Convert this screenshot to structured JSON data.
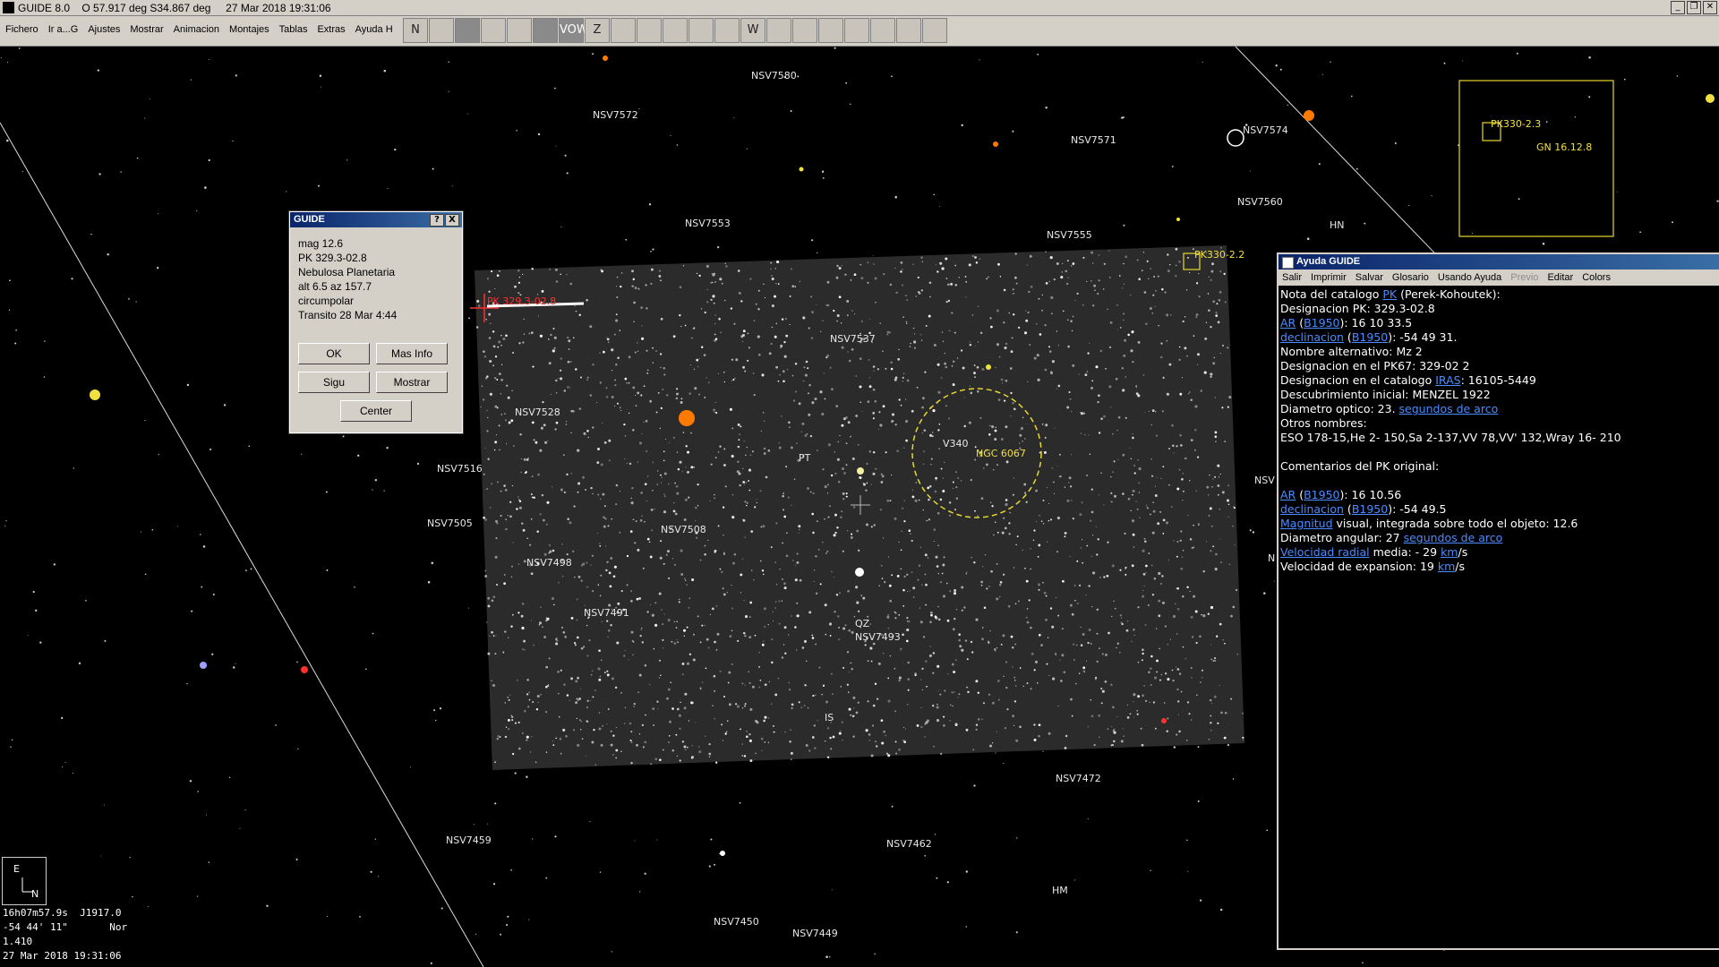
{
  "title_bar": {
    "text": "GUIDE 8.0    O 57.917 deg S34.867 deg     27 Mar 2018 19:31:06"
  },
  "menu": [
    "Fichero",
    "Ir a...G",
    "Ajustes",
    "Mostrar",
    "Animacion",
    "Montajes",
    "Tablas",
    "Extras",
    "Ayuda H"
  ],
  "toolbar": [
    "N",
    "",
    "",
    "",
    "",
    "",
    "VOW",
    "Z",
    "",
    "",
    "",
    "",
    "",
    "W",
    "",
    "",
    "",
    "",
    "",
    "",
    ""
  ],
  "star_labels": [
    "NSV7580",
    "NSV7572",
    "NSV7571",
    "NSV7574",
    "NSV7560",
    "NSV7553",
    "NSV7555",
    "NSV7537",
    "NSV7528",
    "NSV7516",
    "NSV7505",
    "NSV7508",
    "NSV7498",
    "NSV7491",
    "NSV7493",
    "NSV7472",
    "NSV7462",
    "NSV7459",
    "NSV7450",
    "NSV7449",
    "HM",
    "HN",
    "PT",
    "QZ",
    "IS",
    "V340",
    "NSV",
    "N"
  ],
  "object_labels": {
    "pk_tr": "PK330-2.2",
    "target": "PK 329.3-02.8",
    "ngc": "NGC 6067",
    "inset_pk": "PK330-2.3",
    "inset_gn": "GN 16.12.8"
  },
  "dialog": {
    "title": "GUIDE",
    "help_btn": "?",
    "close_btn": "X",
    "lines": [
      "mag 12.6",
      "PK 329.3-02.8",
      "Nebulosa Planetaria",
      "alt  6.5  az  157.7",
      "circumpolar",
      "Transito 28 Mar  4:44"
    ],
    "ok": "OK",
    "mas_info": "Mas Info",
    "sigu": "Sigu",
    "mostrar": "Mostrar",
    "center": "Center"
  },
  "help_window": {
    "title": "Ayuda GUIDE",
    "menu": [
      "Salir",
      "Imprimir",
      "Salvar",
      "Glosario",
      "Usando Ayuda",
      "Previo",
      "Editar",
      "Colors"
    ],
    "lines": [
      [
        {
          "t": "Nota del catalogo "
        },
        {
          "t": "PK",
          "l": 1
        },
        {
          "t": " (Perek-Kohoutek):"
        }
      ],
      [
        {
          "t": "Designacion PK: 329.3-02.8"
        }
      ],
      [
        {
          "t": "AR",
          "l": 1
        },
        {
          "t": " ("
        },
        {
          "t": "B1950",
          "l": 1
        },
        {
          "t": "): 16 10 33.5"
        }
      ],
      [
        {
          "t": "declinacion",
          "l": 1
        },
        {
          "t": " ("
        },
        {
          "t": "B1950",
          "l": 1
        },
        {
          "t": "): -54 49 31."
        }
      ],
      [
        {
          "t": "Nombre alternativo: Mz 2"
        }
      ],
      [
        {
          "t": "Designacion en el PK67: 329-02 2"
        }
      ],
      [
        {
          "t": "Designacion en el catalogo "
        },
        {
          "t": "IRAS",
          "l": 1
        },
        {
          "t": ": 16105-5449"
        }
      ],
      [
        {
          "t": "Descubrimiento inicial: MENZEL 1922"
        }
      ],
      [
        {
          "t": "Diametro optico: 23. "
        },
        {
          "t": "segundos de arco",
          "l": 1
        }
      ],
      [
        {
          "t": "Otros nombres:"
        }
      ],
      [
        {
          "t": "ESO 178-15,He 2- 150,Sa 2-137,VV 78,VV' 132,Wray 16- 210"
        }
      ],
      [
        {
          "t": ""
        }
      ],
      [
        {
          "t": "Comentarios del PK original:"
        }
      ],
      [
        {
          "t": ""
        }
      ],
      [
        {
          "t": "AR",
          "l": 1
        },
        {
          "t": " ("
        },
        {
          "t": "B1950",
          "l": 1
        },
        {
          "t": "): 16 10.56"
        }
      ],
      [
        {
          "t": "declinacion",
          "l": 1
        },
        {
          "t": " ("
        },
        {
          "t": "B1950",
          "l": 1
        },
        {
          "t": "): -54 49.5"
        }
      ],
      [
        {
          "t": "Magnitud",
          "l": 1
        },
        {
          "t": " visual, integrada sobre todo el objeto: 12.6"
        }
      ],
      [
        {
          "t": "Diametro angular: 27 "
        },
        {
          "t": "segundos de arco",
          "l": 1
        }
      ],
      [
        {
          "t": "Velocidad radial",
          "l": 1
        },
        {
          "t": " media: - 29 "
        },
        {
          "t": "km",
          "l": 1
        },
        {
          "t": "/s"
        }
      ],
      [
        {
          "t": "Velocidad de expansion: 19 "
        },
        {
          "t": "km",
          "l": 1
        },
        {
          "t": "/s"
        }
      ]
    ]
  },
  "compass": {
    "east": "E",
    "north": "N"
  },
  "status": {
    "line1": "16h07m57.9s  J1917.0",
    "line2": "-54 44' 11\"       Nor",
    "line3": "1.410",
    "line4": "27 Mar 2018 19:31:06"
  },
  "colors": {
    "label_white": "#e8e8e8",
    "label_yellow": "#f0e040",
    "target_red": "#ff3030",
    "link_blue": "#4a8cff",
    "star_orange": "#ff7a00"
  }
}
